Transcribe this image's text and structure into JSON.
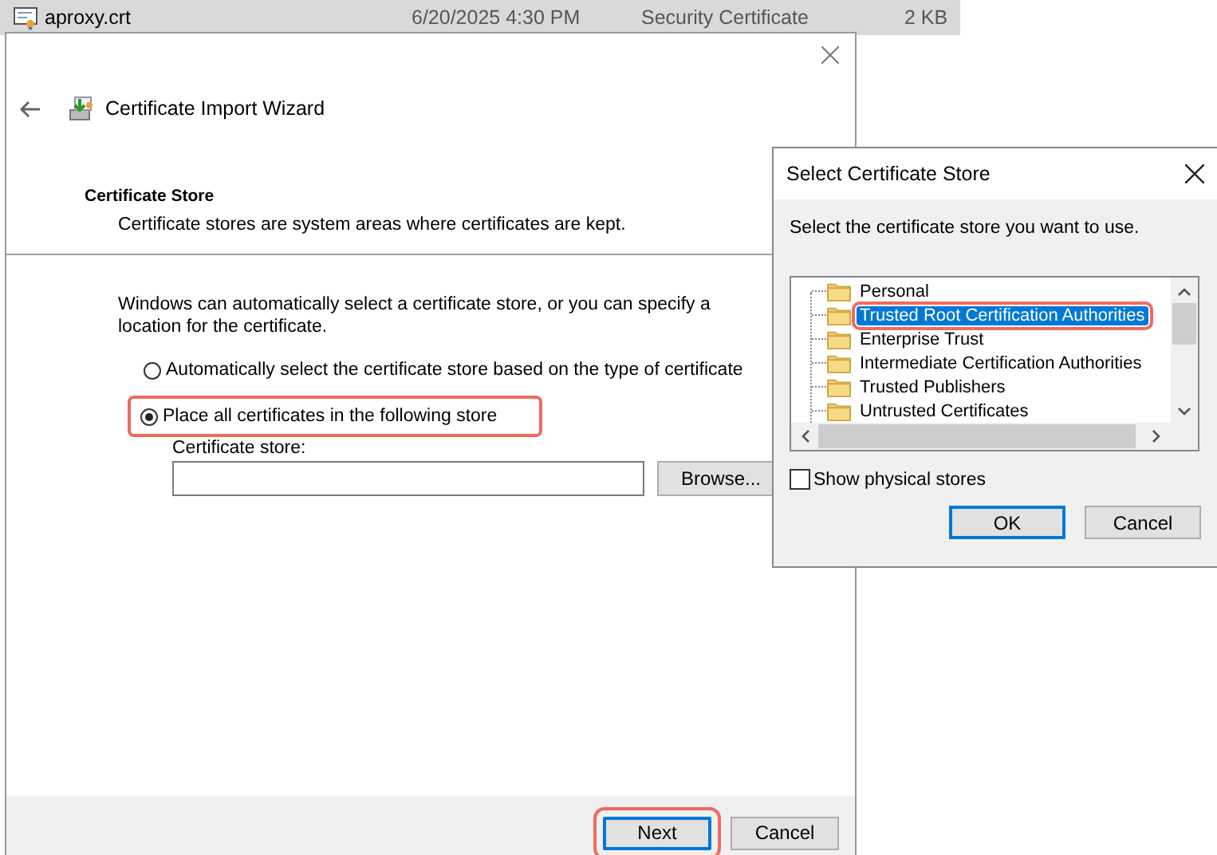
{
  "file_row": {
    "name": "aproxy.crt",
    "date": "6/20/2025 4:30 PM",
    "type": "Security Certificate",
    "size": "2 KB"
  },
  "wizard": {
    "title": "Certificate Import Wizard",
    "section_title": "Certificate Store",
    "section_subtitle": "Certificate stores are system areas where certificates are kept.",
    "description": "Windows can automatically select a certificate store, or you can specify a location for the certificate.",
    "options": [
      {
        "label": "Automatically select the certificate store based on the type of certificate",
        "selected": false,
        "highlighted": false
      },
      {
        "label": "Place all certificates in the following store",
        "selected": true,
        "highlighted": true
      }
    ],
    "store_label": "Certificate store:",
    "browse_button": "Browse...",
    "buttons": [
      {
        "label": "Next",
        "default": true,
        "highlighted": true
      },
      {
        "label": "Cancel",
        "default": false,
        "highlighted": false
      }
    ]
  },
  "dialog": {
    "title": "Select Certificate Store",
    "prompt": "Select the certificate store you want to use.",
    "stores": [
      {
        "label": "Personal",
        "selected": false,
        "highlighted": false
      },
      {
        "label": "Trusted Root Certification Authorities",
        "selected": true,
        "highlighted": true
      },
      {
        "label": "Enterprise Trust",
        "selected": false,
        "highlighted": false
      },
      {
        "label": "Intermediate Certification Authorities",
        "selected": false,
        "highlighted": false
      },
      {
        "label": "Trusted Publishers",
        "selected": false,
        "highlighted": false
      },
      {
        "label": "Untrusted Certificates",
        "selected": false,
        "highlighted": false
      }
    ],
    "show_physical_stores": {
      "label": "Show physical stores",
      "checked": false
    },
    "buttons": [
      {
        "label": "OK",
        "default": true
      },
      {
        "label": "Cancel",
        "default": false
      }
    ]
  }
}
